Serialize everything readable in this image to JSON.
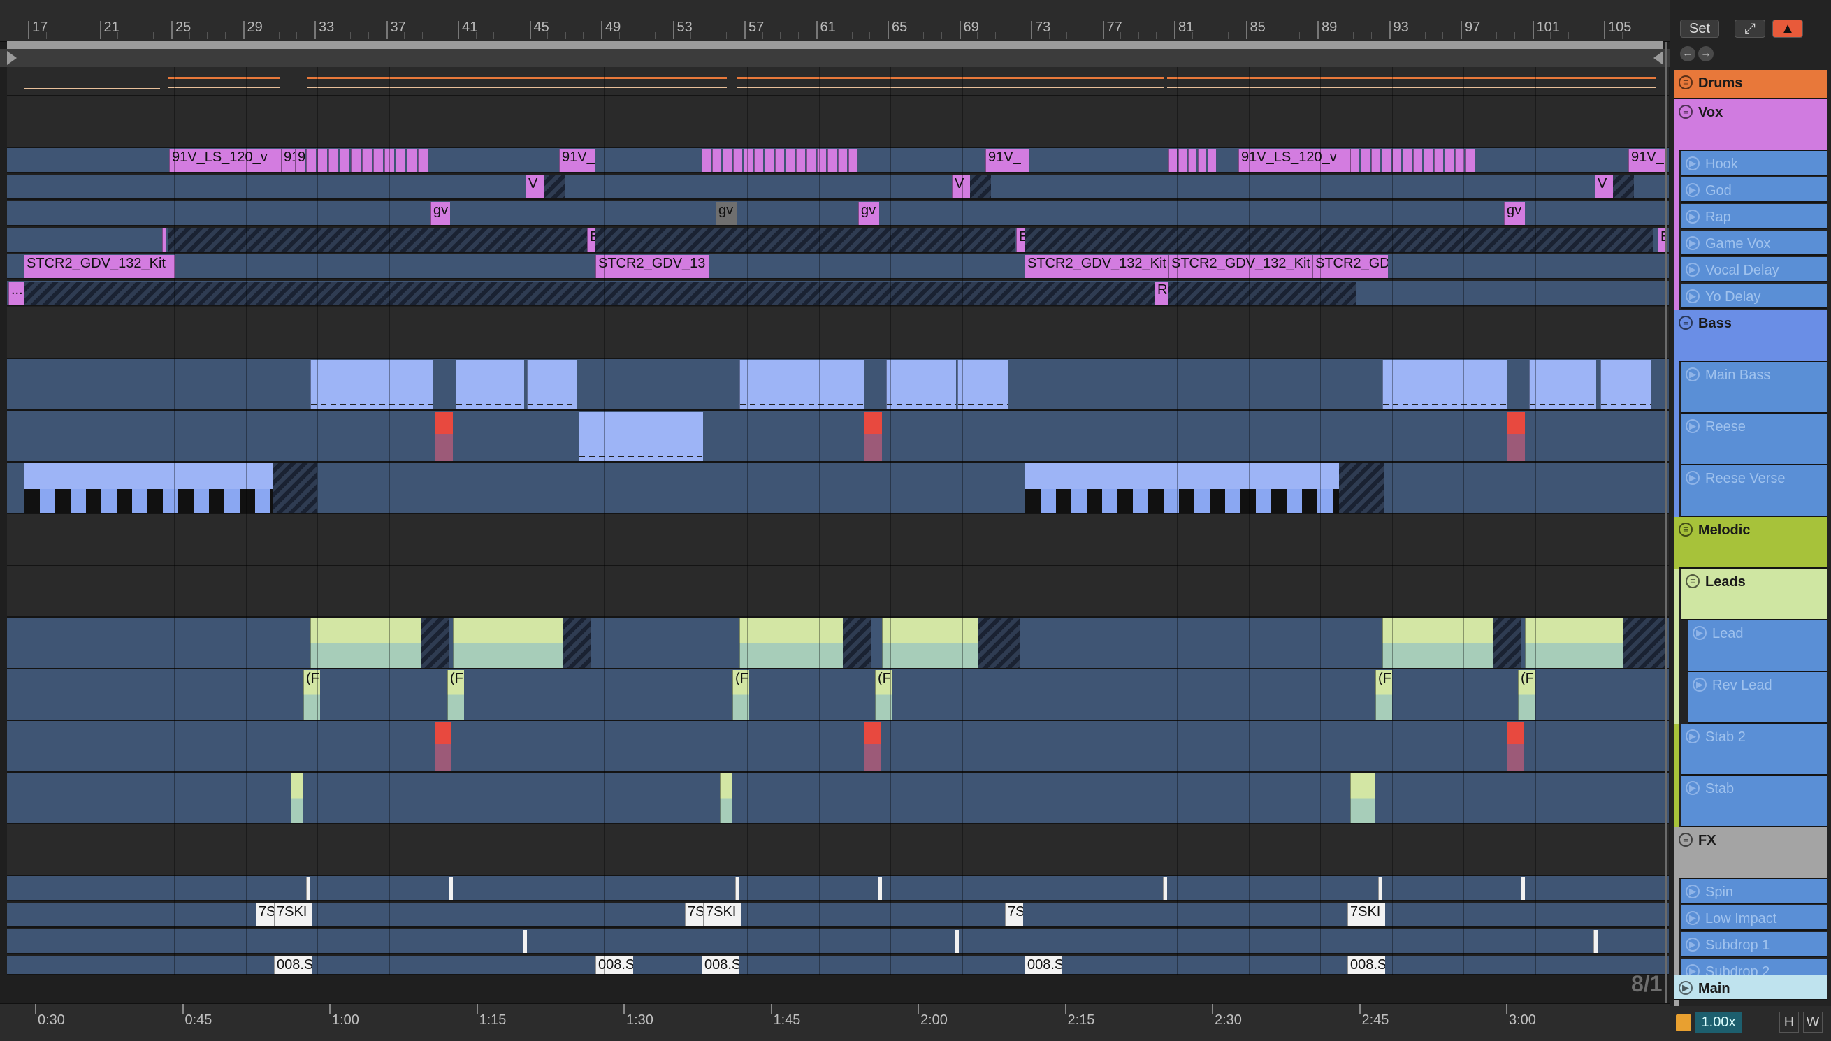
{
  "ruler": {
    "bars": [
      "17",
      "21",
      "25",
      "29",
      "33",
      "37",
      "41",
      "45",
      "49",
      "53",
      "57",
      "61",
      "65",
      "69",
      "73",
      "77",
      "81",
      "85",
      "89",
      "93",
      "97",
      "101",
      "105"
    ]
  },
  "time_ruler": {
    "labels": [
      "0:30",
      "0:45",
      "1:00",
      "1:15",
      "1:30",
      "1:45",
      "2:00",
      "2:15",
      "2:30",
      "2:45",
      "3:00"
    ]
  },
  "signature": "8/1",
  "top_controls": {
    "set_label": "Set",
    "expand_icon": "expand-arrows-icon",
    "lock_icon": "lock-icon",
    "back_icon": "arrow-left-icon",
    "forward_icon": "arrow-right-icon"
  },
  "colors": {
    "drums": "#e8783a",
    "vox": "#d07be0",
    "vox_child": "#5a8fd6",
    "bass": "#6a8ee6",
    "melodic": "#a7c23a",
    "leads": "#cfe6a2",
    "fx": "#a4a4a4",
    "main": "#bfe3ee",
    "clip_pink": "#d37ce0",
    "clip_blue": "#9db4f6",
    "clip_green": "#d3e6a4",
    "clip_red": "#e8493f",
    "clip_white": "#f2f2f2"
  },
  "tracks": [
    {
      "name": "Drums",
      "kind": "group",
      "color": "#e8783a",
      "indent": 0
    },
    {
      "name": "Vox",
      "kind": "group",
      "color": "#d07be0",
      "indent": 0
    },
    {
      "name": "Hook",
      "kind": "track",
      "color": "#5a8fd6",
      "indent": 1
    },
    {
      "name": "God",
      "kind": "track",
      "color": "#5a8fd6",
      "indent": 1
    },
    {
      "name": "Rap",
      "kind": "track",
      "color": "#5a8fd6",
      "indent": 1
    },
    {
      "name": "Game Vox",
      "kind": "track",
      "color": "#5a8fd6",
      "indent": 1
    },
    {
      "name": "Vocal Delay",
      "kind": "track",
      "color": "#5a8fd6",
      "indent": 1
    },
    {
      "name": "Yo Delay",
      "kind": "track",
      "color": "#5a8fd6",
      "indent": 1
    },
    {
      "name": "Bass",
      "kind": "group",
      "color": "#6a8ee6",
      "indent": 0
    },
    {
      "name": "Main Bass",
      "kind": "track",
      "color": "#5a8fd6",
      "indent": 1
    },
    {
      "name": "Reese",
      "kind": "track",
      "color": "#5a8fd6",
      "indent": 1
    },
    {
      "name": "Reese Verse",
      "kind": "track",
      "color": "#5a8fd6",
      "indent": 1
    },
    {
      "name": "Melodic",
      "kind": "group",
      "color": "#a7c23a",
      "indent": 0
    },
    {
      "name": "Leads",
      "kind": "group",
      "color": "#cfe6a2",
      "indent": 1
    },
    {
      "name": "Lead",
      "kind": "track",
      "color": "#5a8fd6",
      "indent": 2
    },
    {
      "name": "Rev Lead",
      "kind": "track",
      "color": "#5a8fd6",
      "indent": 2
    },
    {
      "name": "Stab 2",
      "kind": "track",
      "color": "#5a8fd6",
      "indent": 1
    },
    {
      "name": "Stab",
      "kind": "track",
      "color": "#5a8fd6",
      "indent": 1
    },
    {
      "name": "FX",
      "kind": "group",
      "color": "#a4a4a4",
      "indent": 0
    },
    {
      "name": "Spin",
      "kind": "track",
      "color": "#5a8fd6",
      "indent": 1
    },
    {
      "name": "Low Impact",
      "kind": "track",
      "color": "#5a8fd6",
      "indent": 1
    },
    {
      "name": "Subdrop 1",
      "kind": "track",
      "color": "#5a8fd6",
      "indent": 1
    },
    {
      "name": "Subdrop 2",
      "kind": "track",
      "color": "#5a8fd6",
      "indent": 1
    }
  ],
  "main_track": {
    "name": "Main",
    "icon": "play-icon"
  },
  "clip_names": {
    "hook_a": "91V_LS_120_v",
    "hook_b": "91",
    "hook_c": "9",
    "hook_d": "91V_",
    "hook_e": "91V_LS_120_v",
    "hook_f": "91V_",
    "god_a": "V",
    "rap": "gv",
    "game": "E",
    "vd_a": "STCR2_GDV_132_Kit",
    "vd_b": "STCR2_GDV_13",
    "vd_c": "STCR2_GDV_132_Kit",
    "vd_d": "STCR2_GDV_132_Kit",
    "vd_e": "STCR2_GD",
    "yo_a": "...",
    "yo_b": "R",
    "rev": "(F",
    "low_a": "7S",
    "low_b": "7SKI",
    "sub2": "008.S"
  },
  "bottom_controls": {
    "zoom": "1.00x",
    "h_label": "H",
    "w_label": "W",
    "meter_icon": "level-meter-icon"
  }
}
